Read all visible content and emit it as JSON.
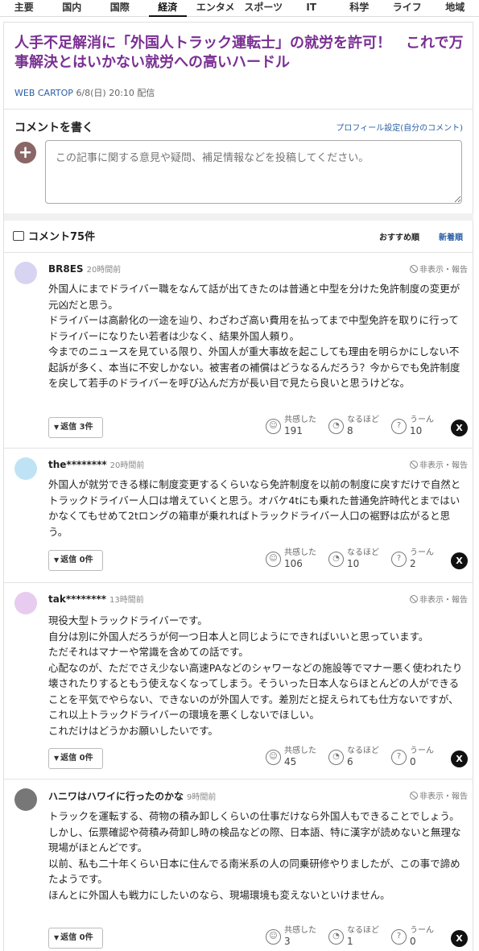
{
  "nav": [
    "主要",
    "国内",
    "国際",
    "経済",
    "エンタメ",
    "スポーツ",
    "IT",
    "科学",
    "ライフ",
    "地域"
  ],
  "nav_active_index": 3,
  "article": {
    "title": "人手不足解消に「外国人トラック運転士」の就労を許可！　これで万事解決とはいかない就労への高いハードル",
    "source": "WEB CARTOP",
    "date": "6/8(日) 20:10 配信"
  },
  "write": {
    "title": "コメントを書く",
    "profile_link": "プロフィール設定(自分のコメント)",
    "placeholder": "この記事に関する意見や疑問、補足情報などを投稿してください。"
  },
  "comments_header": {
    "count_label": "コメント75件",
    "sort_recommended": "おすすめ順",
    "sort_newest": "新着順"
  },
  "report_label": "非表示・報告",
  "reaction_labels": {
    "empathy": "共感した",
    "convinced": "なるほど",
    "hmm": "うーん"
  },
  "comments": [
    {
      "user": "BR8ES",
      "time": "20時間前",
      "avatar_color": "#d7d4f2",
      "lines": [
        "外国人にまでドライバー職をなんて話が出てきたのは普通と中型を分けた免許制度の変更が元凶だと思う。",
        "ドライバーは高齢化の一途を辿り、わざわざ高い費用を払ってまで中型免許を取りに行ってドライバーになりたい若者は少なく、結果外国人頼り。",
        "今までのニュースを見ている限り、外国人が重大事故を起こしても理由を明らかにしない不起訴が多く、本当に不安しかない。被害者の補償はどうなるんだろう？今からでも免許制度を戻して若手のドライバーを呼び込んだ方が長い目で見たら良いと思うけどな。"
      ],
      "reply": "返信 3件",
      "empathy": "191",
      "convinced": "8",
      "hmm": "10"
    },
    {
      "user": "the********",
      "time": "20時間前",
      "avatar_color": "#bfe3f5",
      "lines": [
        "外国人が就労できる様に制度変更するくらいなら免許制度を以前の制度に戻すだけで自然とトラックドライバー人口は増えていくと思う。オバケ4tにも乗れた普通免許時代とまではいかなくてもせめて2tロングの箱車が乗れればトラックドライバー人口の裾野は広がると思う。"
      ],
      "reply": "返信 0件",
      "empathy": "106",
      "convinced": "10",
      "hmm": "2"
    },
    {
      "user": "tak********",
      "time": "13時間前",
      "avatar_color": "#e7ccef",
      "lines": [
        "現役大型トラックドライバーです。",
        "自分は別に外国人だろうが何一つ日本人と同じようにできればいいと思っています。",
        "ただそれはマナーや常識を含めての話です。",
        "心配なのが、ただでさえ少ない高速PAなどのシャワーなどの施設等でマナー悪く使われたり壊されたりするともう使えなくなってしまう。そういった日本人ならほとんどの人ができることを平気でやらない、できないのが外国人です。差別だと捉えられても仕方ないですが、これ以上トラックドライバーの環境を悪くしないでほしい。",
        "これだけはどうかお願いしたいです。"
      ],
      "reply": "返信 0件",
      "empathy": "45",
      "convinced": "6",
      "hmm": "0"
    },
    {
      "user": "ハニワはハワイに行ったのかな",
      "time": "9時間前",
      "avatar_color": "#777777",
      "lines": [
        "トラックを運転する、荷物の積み卸しくらいの仕事だけなら外国人もできることでしょう。",
        "しかし、伝票確認や荷積み荷卸し時の検品などの際、日本語、特に漢字が読めないと無理な現場がほとんどです。",
        "以前、私も二十年くらい日本に住んでる南米系の人の同乗研修やりましたが、この事で諦めたようです。",
        "ほんとに外国人も戦力にしたいのなら、現場環境も変えないといけません。"
      ],
      "reply": "返信 0件",
      "empathy": "3",
      "convinced": "1",
      "hmm": "0"
    }
  ]
}
